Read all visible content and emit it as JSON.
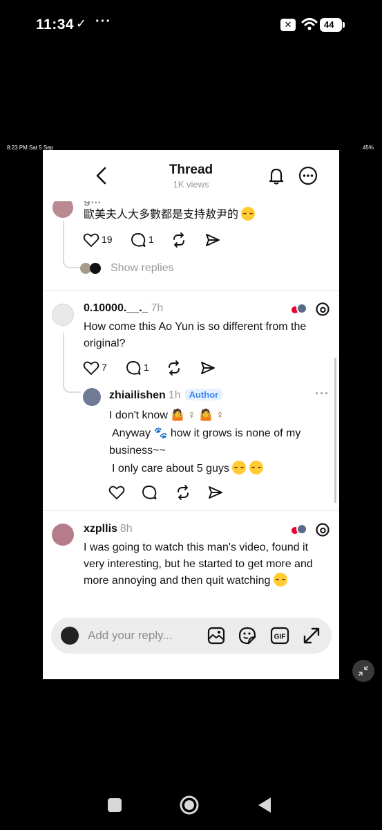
{
  "status_bar": {
    "time": "11:34",
    "battery": "44"
  },
  "mini_status": {
    "time": "8:23 PM  Sat 5 Sep",
    "battery": "45%"
  },
  "header": {
    "title": "Thread",
    "views": "1K views"
  },
  "comments": [
    {
      "username": "g…",
      "text": "歐美夫人大多數都是支持敖尹的",
      "likes": "19",
      "replies": "1",
      "show_replies": "Show replies"
    },
    {
      "username": "0.10000.__._",
      "time": "7h",
      "text": "How come this Ao Yun is so different from the original?",
      "likes": "7",
      "replies": "1"
    },
    {
      "username": "zhiailishen",
      "time": "1h",
      "badge": "Author",
      "line1": "I don't know",
      "line2": "Anyway",
      "line2b": "how it grows is none of my",
      "line3": "business~~",
      "line4": "I only care about 5 guys"
    },
    {
      "username": "xzpllis",
      "time": "8h",
      "text": "I was going to watch this man's video, found it very interesting, but he started to get more and more annoying and then quit watching"
    }
  ],
  "reply_bar": {
    "placeholder": "Add your reply..."
  },
  "icons": [
    "back-icon",
    "bell-icon",
    "more-icon",
    "heart-icon",
    "comment-icon",
    "repost-icon",
    "share-icon",
    "threads-icon",
    "gallery-icon",
    "sticker-icon",
    "gif-icon",
    "expand-icon"
  ]
}
